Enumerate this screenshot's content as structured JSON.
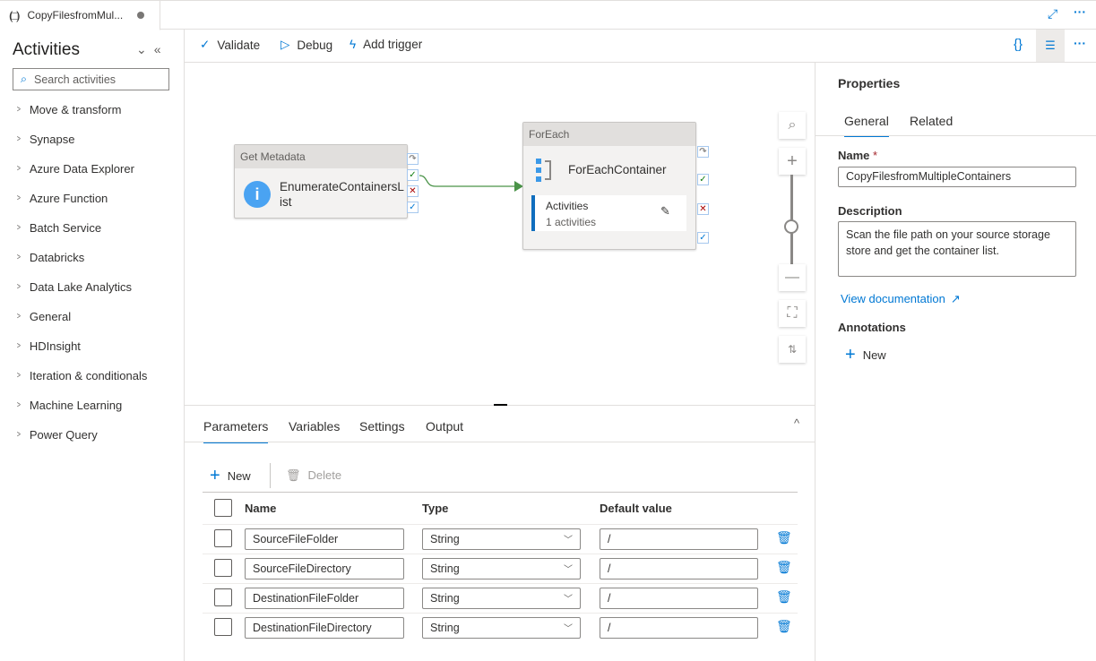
{
  "tab": {
    "title": "CopyFilesfromMul...",
    "unsaved": true
  },
  "window_actions": {
    "expand": "expand-icon",
    "more": "···"
  },
  "sidebar": {
    "title": "Activities",
    "search_placeholder": "Search activities",
    "categories": [
      "Move & transform",
      "Synapse",
      "Azure Data Explorer",
      "Azure Function",
      "Batch Service",
      "Databricks",
      "Data Lake Analytics",
      "General",
      "HDInsight",
      "Iteration & conditionals",
      "Machine Learning",
      "Power Query"
    ]
  },
  "toolbar": {
    "validate": "Validate",
    "debug": "Debug",
    "add_trigger": "Add trigger",
    "code": "{}",
    "more": "···"
  },
  "canvas": {
    "get_metadata": {
      "type": "Get Metadata",
      "name_line1": "EnumerateContainersL",
      "name_line2": "ist"
    },
    "foreach": {
      "type": "ForEach",
      "name": "ForEachContainer",
      "inner_label": "Activities",
      "inner_count": "1 activities"
    }
  },
  "properties": {
    "title": "Properties",
    "tabs": [
      "General",
      "Related"
    ],
    "active_tab": "General",
    "name_label": "Name",
    "required_mark": "*",
    "name_value": "CopyFilesfromMultipleContainers",
    "description_label": "Description",
    "description_value": "Scan the file path on your source storage store and get the container list.",
    "view_doc": "View documentation",
    "annotations_label": "Annotations",
    "new_label": "New"
  },
  "bottom": {
    "tabs": [
      "Parameters",
      "Variables",
      "Settings",
      "Output"
    ],
    "active_tab": "Parameters",
    "new_label": "New",
    "delete_label": "Delete",
    "columns": [
      "Name",
      "Type",
      "Default value"
    ],
    "rows": [
      {
        "name": "SourceFileFolder",
        "type": "String",
        "default": "/"
      },
      {
        "name": "SourceFileDirectory",
        "type": "String",
        "default": "/"
      },
      {
        "name": "DestinationFileFolder",
        "type": "String",
        "default": "/"
      },
      {
        "name": "DestinationFileDirectory",
        "type": "String",
        "default": "/"
      }
    ]
  },
  "colors": {
    "accent": "#0078d4",
    "success": "#107c10",
    "failure": "#a80000"
  }
}
